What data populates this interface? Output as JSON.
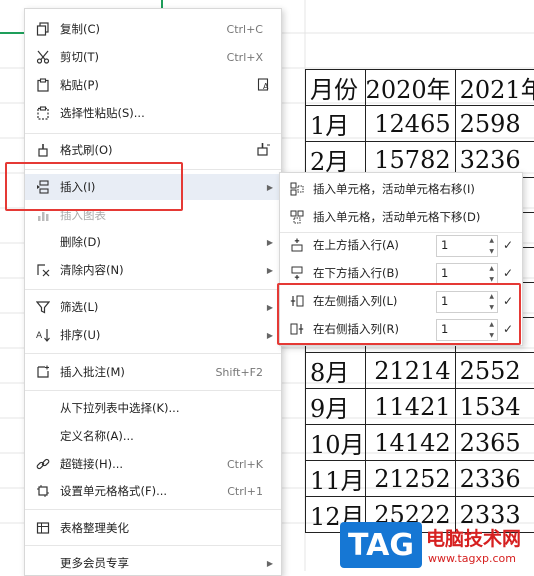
{
  "menu": {
    "items": [
      {
        "label": "复制(C)",
        "shortcut": "Ctrl+C",
        "icon": "copy-icon"
      },
      {
        "label": "剪切(T)",
        "shortcut": "Ctrl+X",
        "icon": "scissors-icon"
      },
      {
        "label": "粘贴(P)",
        "shortcut": "",
        "icon": "paste-icon"
      },
      {
        "label": "选择性粘贴(S)...",
        "shortcut": "",
        "icon": "paste-special-icon"
      },
      {
        "label": "格式刷(O)",
        "shortcut": "",
        "icon": "format-brush-icon"
      },
      {
        "label": "插入(I)",
        "shortcut": "",
        "icon": "insert-icon"
      },
      {
        "label": "插入图表",
        "shortcut": "",
        "icon": "chart-icon"
      },
      {
        "label": "删除(D)",
        "shortcut": "",
        "icon": ""
      },
      {
        "label": "清除内容(N)",
        "shortcut": "",
        "icon": "clear-icon"
      },
      {
        "label": "筛选(L)",
        "shortcut": "",
        "icon": "filter-icon"
      },
      {
        "label": "排序(U)",
        "shortcut": "",
        "icon": "sort-icon"
      },
      {
        "label": "插入批注(M)",
        "shortcut": "Shift+F2",
        "icon": "comment-icon"
      },
      {
        "label": "从下拉列表中选择(K)...",
        "shortcut": "",
        "icon": ""
      },
      {
        "label": "定义名称(A)...",
        "shortcut": "",
        "icon": ""
      },
      {
        "label": "超链接(H)...",
        "shortcut": "Ctrl+K",
        "icon": "link-icon"
      },
      {
        "label": "设置单元格格式(F)...",
        "shortcut": "Ctrl+1",
        "icon": "cell-format-icon"
      },
      {
        "label": "表格整理美化",
        "shortcut": "",
        "icon": "table-beautify-icon"
      },
      {
        "label": "更多会员专享",
        "shortcut": "",
        "icon": ""
      }
    ]
  },
  "submenu": {
    "items": [
      {
        "label": "插入单元格，活动单元格右移(I)"
      },
      {
        "label": "插入单元格，活动单元格下移(D)"
      },
      {
        "label": "在上方插入行(A)",
        "count": "1"
      },
      {
        "label": "在下方插入行(B)",
        "count": "1"
      },
      {
        "label": "在左侧插入列(L)",
        "count": "1"
      },
      {
        "label": "在右侧插入列(R)",
        "count": "1"
      }
    ]
  },
  "sheet": {
    "header": [
      "月份",
      "2020年",
      "2021年"
    ],
    "rows": [
      [
        "1月",
        "12465",
        "2598"
      ],
      [
        "2月",
        "15782",
        "3236"
      ],
      [
        "",
        "",
        ""
      ],
      [
        "",
        "",
        ""
      ],
      [
        "",
        "",
        ""
      ],
      [
        "",
        "",
        ""
      ],
      [
        "",
        "",
        ""
      ],
      [
        "8月",
        "21214",
        "2552"
      ],
      [
        "9月",
        "11421",
        "1534"
      ],
      [
        "10月",
        "14142",
        "2365"
      ],
      [
        "11月",
        "21252",
        "2336"
      ],
      [
        "12月",
        "25222",
        "2333"
      ]
    ]
  },
  "watermark": {
    "tag": "TAG",
    "title": "电脑技术网",
    "url": "www.tagxp.com"
  },
  "colors": {
    "highlight_box": "#e53935",
    "accent": "#1677d4"
  }
}
